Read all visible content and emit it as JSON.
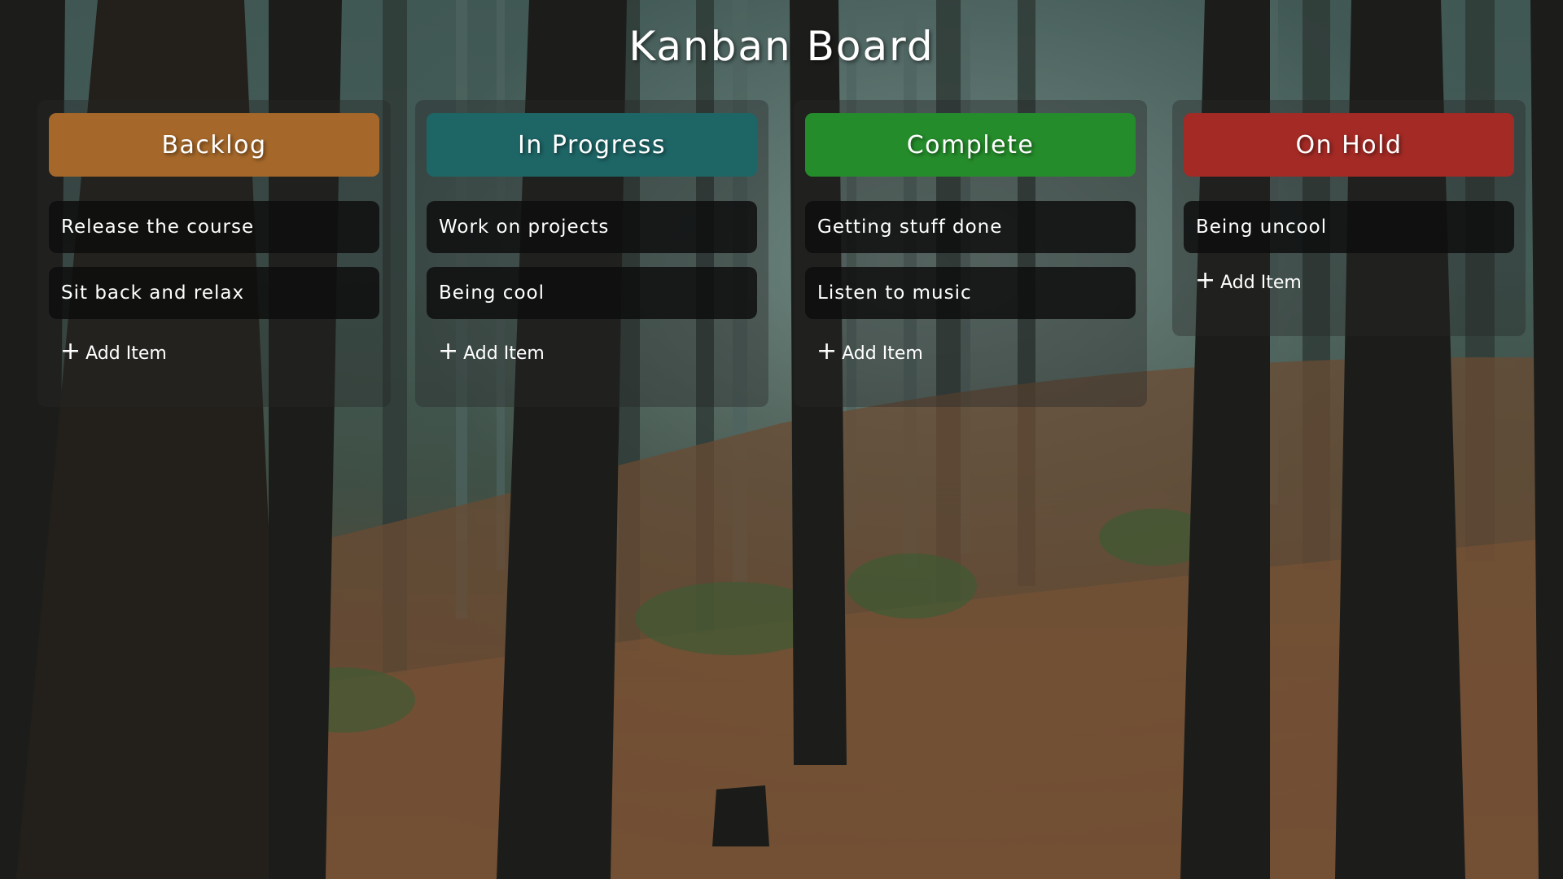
{
  "page": {
    "title": "Kanban Board"
  },
  "background": {
    "description_icon": "forest-photo"
  },
  "columns": [
    {
      "header": "Backlog",
      "color": "#A5682A",
      "items": [
        "Release the course",
        "Sit back and relax"
      ],
      "add_label": "Add Item",
      "add_icon": "plus-icon"
    },
    {
      "header": "In Progress",
      "color": "#1E6566",
      "items": [
        "Work on projects",
        "Being cool"
      ],
      "add_label": "Add Item",
      "add_icon": "plus-icon"
    },
    {
      "header": "Complete",
      "color": "#258C2B",
      "items": [
        "Getting stuff done",
        "Listen to music"
      ],
      "add_label": "Add Item",
      "add_icon": "plus-icon"
    },
    {
      "header": "On Hold",
      "color": "#A32A25",
      "items": [
        "Being uncool"
      ],
      "add_label": "Add Item",
      "add_icon": "plus-icon"
    }
  ]
}
